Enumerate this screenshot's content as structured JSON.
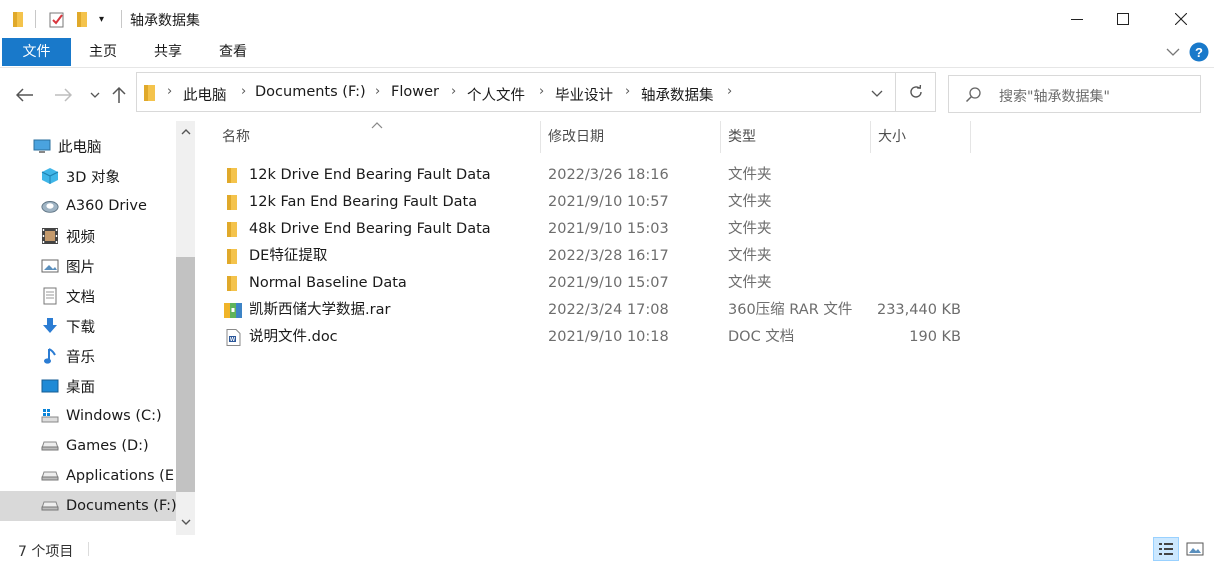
{
  "window": {
    "title": "轴承数据集"
  },
  "ribbon": {
    "tabs": [
      "文件",
      "主页",
      "共享",
      "查看"
    ]
  },
  "address": {
    "crumbs": [
      "此电脑",
      "Documents (F:)",
      "Flower",
      "个人文件",
      "毕业设计",
      "轴承数据集"
    ]
  },
  "search": {
    "placeholder": "搜索\"轴承数据集\""
  },
  "sidebar": {
    "items": [
      {
        "label": "此电脑",
        "icon": "pc-icon"
      },
      {
        "label": "3D 对象",
        "icon": "3d-objects-icon"
      },
      {
        "label": "A360 Drive",
        "icon": "a360-drive-icon"
      },
      {
        "label": "视频",
        "icon": "video-icon"
      },
      {
        "label": "图片",
        "icon": "pictures-icon"
      },
      {
        "label": "文档",
        "icon": "documents-icon"
      },
      {
        "label": "下载",
        "icon": "download-icon"
      },
      {
        "label": "音乐",
        "icon": "music-icon"
      },
      {
        "label": "桌面",
        "icon": "desktop-icon"
      },
      {
        "label": "Windows (C:)",
        "icon": "windows-drive-icon"
      },
      {
        "label": "Games (D:)",
        "icon": "drive-icon"
      },
      {
        "label": "Applications (E",
        "icon": "drive-icon"
      },
      {
        "label": "Documents (F:)",
        "icon": "drive-icon"
      }
    ]
  },
  "columns": {
    "name": "名称",
    "date": "修改日期",
    "type": "类型",
    "size": "大小"
  },
  "files": [
    {
      "name": "12k Drive End Bearing Fault Data",
      "date": "2022/3/26 18:16",
      "type": "文件夹",
      "size": "",
      "icon": "folder-icon"
    },
    {
      "name": "12k Fan End Bearing Fault Data",
      "date": "2021/9/10 10:57",
      "type": "文件夹",
      "size": "",
      "icon": "folder-icon"
    },
    {
      "name": "48k Drive End Bearing Fault Data",
      "date": "2021/9/10 15:03",
      "type": "文件夹",
      "size": "",
      "icon": "folder-icon"
    },
    {
      "name": "DE特征提取",
      "date": "2022/3/28 16:17",
      "type": "文件夹",
      "size": "",
      "icon": "folder-icon"
    },
    {
      "name": "Normal Baseline Data",
      "date": "2021/9/10 15:07",
      "type": "文件夹",
      "size": "",
      "icon": "folder-icon"
    },
    {
      "name": "凯斯西储大学数据.rar",
      "date": "2022/3/24 17:08",
      "type": "360压缩 RAR 文件",
      "size": "233,440 KB",
      "icon": "rar-archive-icon"
    },
    {
      "name": "说明文件.doc",
      "date": "2021/9/10 10:18",
      "type": "DOC 文档",
      "size": "190 KB",
      "icon": "word-doc-icon"
    }
  ],
  "status": {
    "count": "7 个项目"
  },
  "colors": {
    "accent": "#1979ca",
    "folder": "#f4c34c",
    "selected": "#cce8ff"
  }
}
